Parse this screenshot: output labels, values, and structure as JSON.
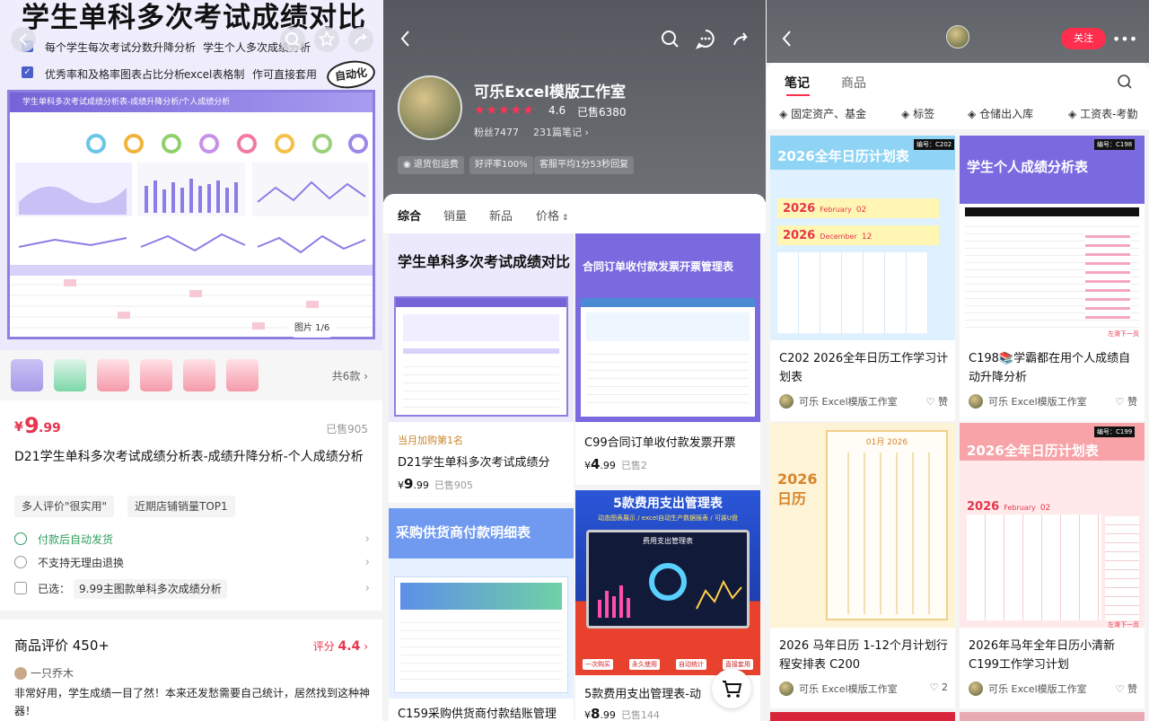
{
  "panel1": {
    "hero_title": "学生单科多次考试成绩对比",
    "features": [
      "每个学生每次考试分数升降分析",
      "学生个人多次成绩分析",
      "优秀率和及格率图表占比分析",
      "excel表格制",
      "作可直接套用"
    ],
    "stamp": "自动化",
    "sheet_title": "学生单科多次考试成绩分析表-成绩升降分析/个人成绩分析",
    "image_pager": "图片 1/6",
    "total_styles": "共6款",
    "price_yuan": "9",
    "price_cents": ".99",
    "price_symbol": "¥",
    "sold": "已售905",
    "product_title": "D21学生单科多次考试成绩分析表-成绩升降分析-个人成绩分析",
    "tags": [
      "多人评价\"很实用\"",
      "近期店铺销量TOP1"
    ],
    "services": [
      "付款后自动发货",
      "不支持无理由退换",
      "已选："
    ],
    "selected_option": "9.99主图款单科多次成绩分析",
    "review_title": "商品评价 450+",
    "score_label": "评分",
    "score": "4.4",
    "reviewer": "一只乔木",
    "review_text": "非常好用，学生成绩一目了然！本来还发愁需要自己统计，居然找到这种神器！"
  },
  "panel2": {
    "shop_name": "可乐Excel模版工作室",
    "rating": "4.6",
    "shop_sold": "已售6380",
    "fans": "粉丝7477",
    "notes": "231篇笔记",
    "pills": [
      "退货包运费",
      "好评率100%",
      "客服平均1分53秒回复"
    ],
    "sort_tabs": [
      "综合",
      "销量",
      "新品",
      "价格"
    ],
    "products": [
      {
        "badge": "当月加购第1名",
        "title": "D21学生单科多次考试成绩分",
        "yuan": "9",
        "cents": ".99",
        "sold": "已售905",
        "img_title": "学生单科多次考试成绩对比"
      },
      {
        "badge": "",
        "title": "C99合同订单收付款发票开票",
        "yuan": "4",
        "cents": ".99",
        "sold": "已售2",
        "img_title": "合同订单收付款发票开票管理表"
      },
      {
        "badge": "",
        "title": "C159采购供货商付款结账管理",
        "yuan": "",
        "cents": "",
        "sold": "",
        "img_title": "采购供货商付款明细表"
      },
      {
        "badge": "",
        "title": "5款费用支出管理表-动",
        "yuan": "8",
        "cents": ".99",
        "sold": "已售144",
        "img_title": "5款费用支出管理表"
      }
    ],
    "card_sub": "动态图表展示 / excel自动生产数据报表 / 可装U盘",
    "card_screen": "费用支出管理表",
    "card_pills": [
      "一次购买",
      "永久使用",
      "自动统计",
      "直接套用"
    ]
  },
  "panel3": {
    "follow": "关注",
    "tabs": [
      "笔记",
      "商品"
    ],
    "cats": [
      "固定资产、基金",
      "标签",
      "仓储出入库",
      "工资表-考勤"
    ],
    "notes": [
      {
        "title": "C202 2026全年日历工作学习计划表",
        "author": "可乐 Excel模版工作室",
        "like": "赞",
        "img_title": "2026全年日历计划表",
        "code": "编号：C202",
        "m1": "February",
        "d1": "02",
        "m2": "December",
        "d2": "12",
        "year": "2026"
      },
      {
        "title": "C198📚学霸都在用个人成绩自动升降分析",
        "author": "可乐 Excel模版工作室",
        "like": "赞",
        "img_title": "学生个人成绩分析表",
        "code": "编号：C198",
        "m1": "",
        "d1": "",
        "m2": "",
        "d2": "",
        "year": ""
      },
      {
        "title": "2026 马年日历 1-12个月计划行程安排表 C200",
        "author": "可乐 Excel模版工作室",
        "like": "2",
        "img_title": "2026日历",
        "code": "",
        "m1": "01月",
        "d1": "",
        "m2": "",
        "d2": "",
        "year": "2026"
      },
      {
        "title": "2026年马年全年日历小清新C199工作学习计划",
        "author": "可乐 Excel模版工作室",
        "like": "赞",
        "img_title": "2026全年日历计划表",
        "code": "编号：C199",
        "m1": "February",
        "d1": "02",
        "m2": "",
        "d2": "",
        "year": "2026"
      }
    ],
    "swipe_hint": "左滑下一页"
  },
  "colors": {
    "accent": "#e8344e",
    "purple": "#7a6ae0",
    "follow": "#ff2e4d"
  }
}
